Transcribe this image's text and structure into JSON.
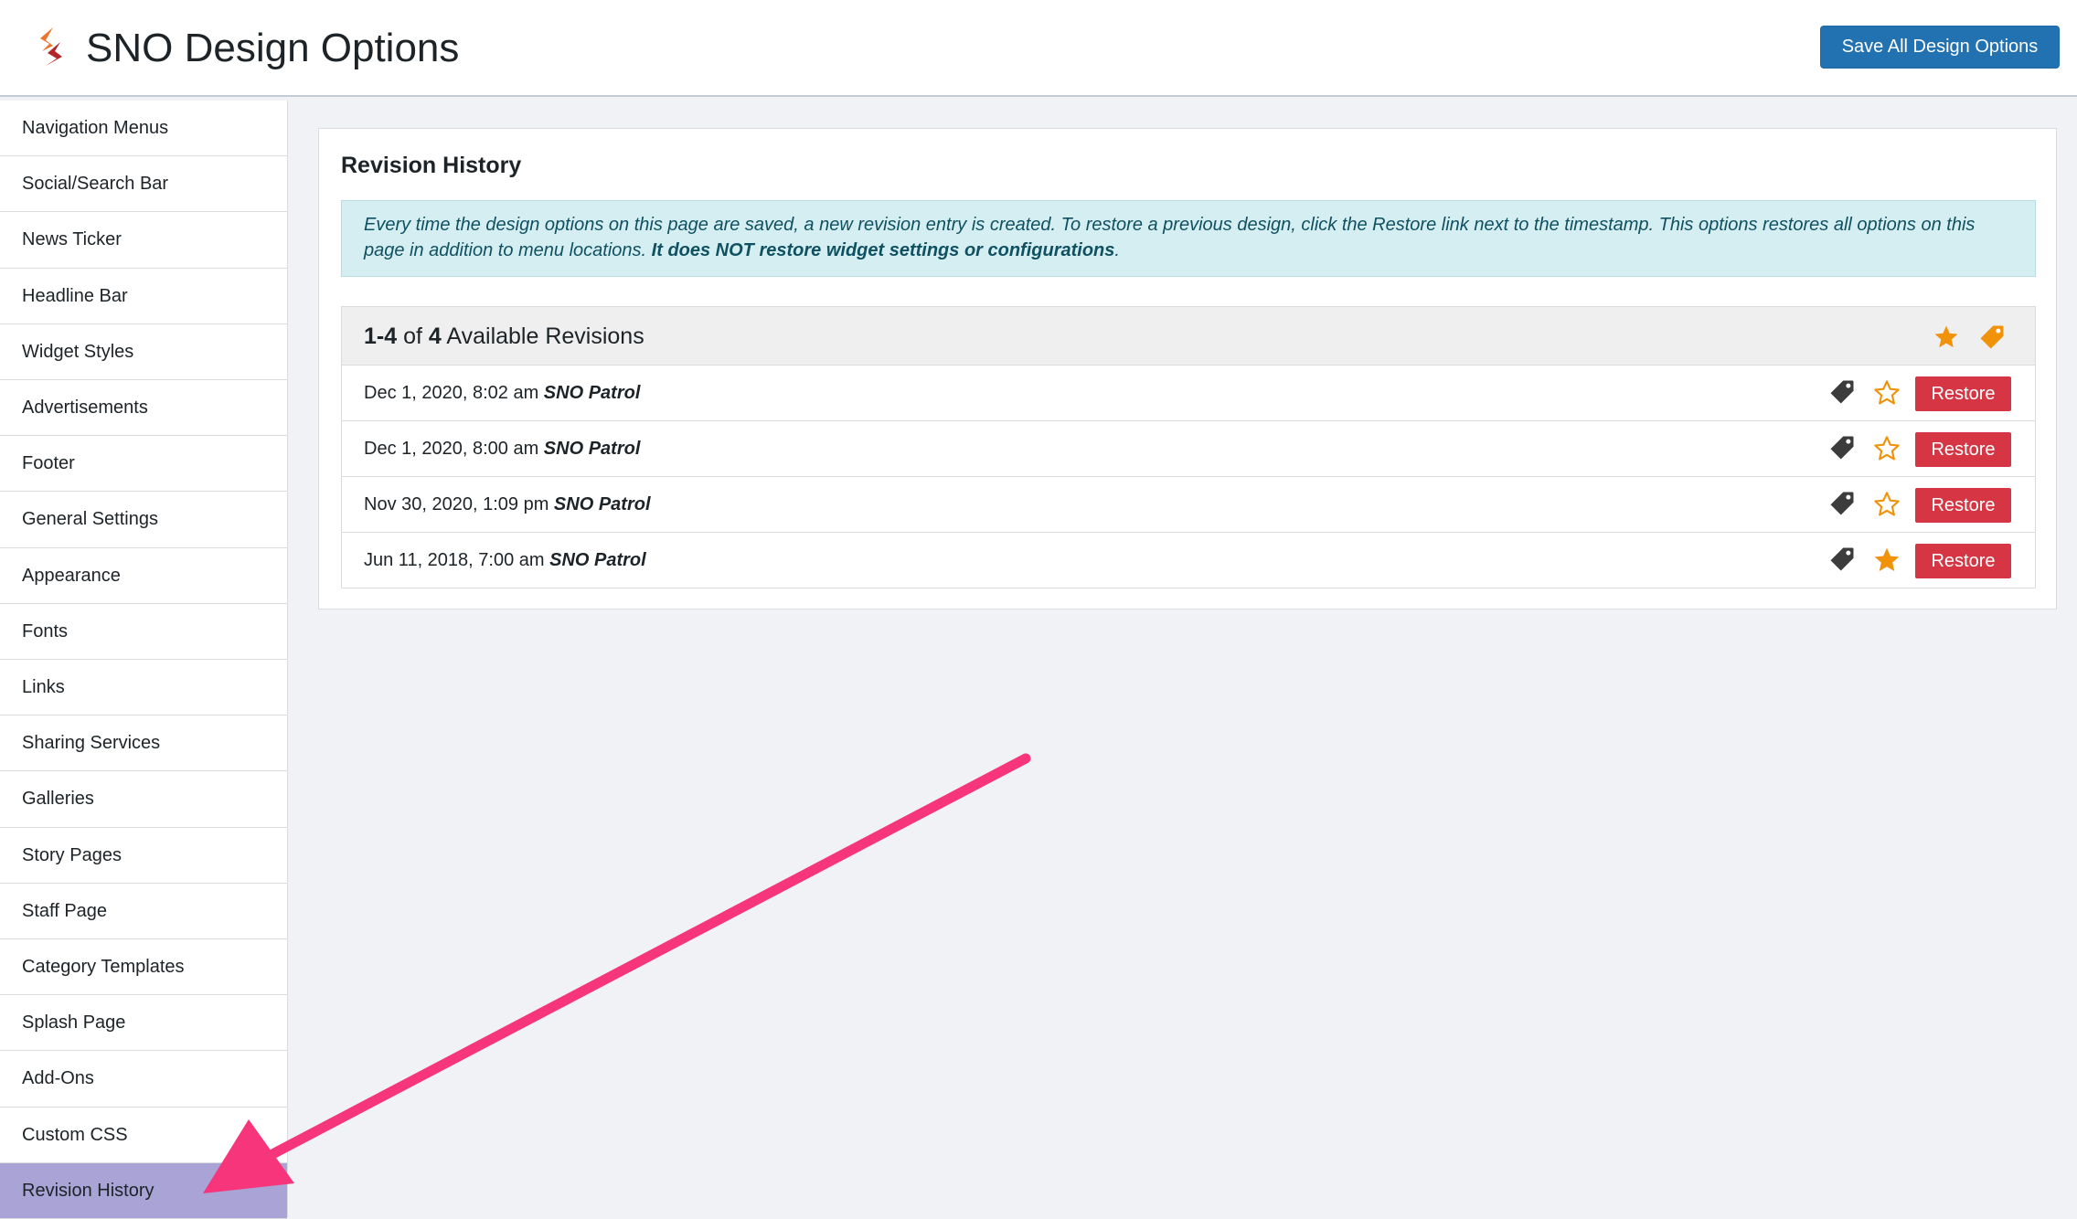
{
  "header": {
    "title": "SNO Design Options",
    "save_label": "Save All Design Options"
  },
  "sidebar": {
    "items": [
      {
        "label": "Navigation Menus"
      },
      {
        "label": "Social/Search Bar"
      },
      {
        "label": "News Ticker"
      },
      {
        "label": "Headline Bar"
      },
      {
        "label": "Widget Styles"
      },
      {
        "label": "Advertisements"
      },
      {
        "label": "Footer"
      },
      {
        "label": "General Settings"
      },
      {
        "label": "Appearance"
      },
      {
        "label": "Fonts"
      },
      {
        "label": "Links"
      },
      {
        "label": "Sharing Services"
      },
      {
        "label": "Galleries"
      },
      {
        "label": "Story Pages"
      },
      {
        "label": "Staff Page"
      },
      {
        "label": "Category Templates"
      },
      {
        "label": "Splash Page"
      },
      {
        "label": "Add-Ons"
      },
      {
        "label": "Custom CSS"
      },
      {
        "label": "Revision History",
        "active": true
      }
    ]
  },
  "main": {
    "title": "Revision History",
    "notice": {
      "text": "Every time the design options on this page are saved, a new revision entry is created. To restore a previous design, click the Restore link next to the timestamp. This options restores all options on this page in addition to menu locations. ",
      "emphasis": "It does NOT restore widget settings or configurations",
      "tail": "."
    },
    "revisions": {
      "range": "1-4",
      "of_label": "of",
      "total": "4",
      "suffix": "Available Revisions",
      "rows": [
        {
          "date": "Dec 1, 2020, 8:02 am",
          "author": "SNO Patrol",
          "starred": false,
          "restore_label": "Restore"
        },
        {
          "date": "Dec 1, 2020, 8:00 am",
          "author": "SNO Patrol",
          "starred": false,
          "restore_label": "Restore"
        },
        {
          "date": "Nov 30, 2020, 1:09 pm",
          "author": "SNO Patrol",
          "starred": false,
          "restore_label": "Restore"
        },
        {
          "date": "Jun 11, 2018, 7:00 am",
          "author": "SNO Patrol",
          "starred": true,
          "restore_label": "Restore"
        }
      ]
    }
  },
  "icons": {
    "logo": "sno-logo-icon",
    "star_filled": "star-filled-icon",
    "star_outline": "star-outline-icon",
    "tag": "tag-icon"
  },
  "colors": {
    "accent_blue": "#2271b1",
    "restore_red": "#d63644",
    "star_orange": "#f0930b",
    "notice_bg": "#d5eef2",
    "active_sidebar": "#a9a3d6",
    "annotation_arrow": "#f7357a"
  }
}
